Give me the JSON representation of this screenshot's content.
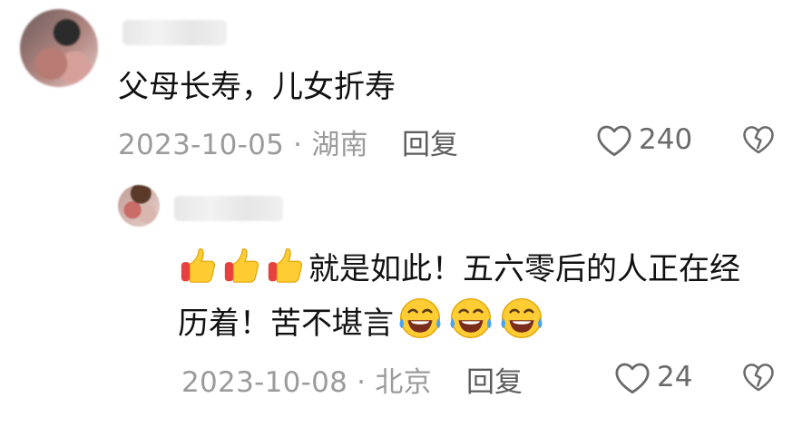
{
  "comment": {
    "text": "父母长寿，儿女折寿",
    "date": "2023-10-05",
    "separator": "·",
    "location": "湖南",
    "reply_label": "回复",
    "likes": "240"
  },
  "reply": {
    "text_part1": "就是如此！五六零后的人正在经",
    "text_part2": "历着！苦不堪言",
    "date": "2023-10-08",
    "separator": "·",
    "location": "北京",
    "reply_label": "回复",
    "likes": "24"
  },
  "icons": [
    "heart-outline-icon",
    "broken-heart-icon",
    "thumbs-up-emoji",
    "laughing-tears-emoji"
  ]
}
